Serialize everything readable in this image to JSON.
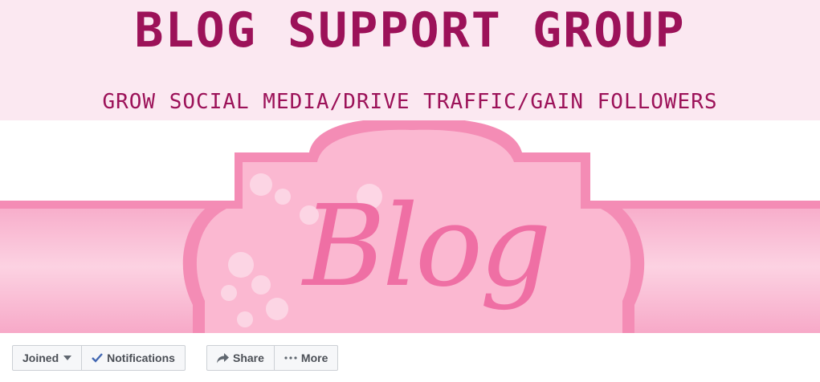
{
  "cover": {
    "title": "BLOG SUPPORT GROUP",
    "subtitle": "GROW SOCIAL MEDIA/DRIVE TRAFFIC/GAIN FOLLOWERS",
    "art_text": "Blog",
    "colors": {
      "title": "#9c1259",
      "band": "#fbe8f1",
      "pink": "#f48cb5",
      "light_pink": "#fcc3d8"
    }
  },
  "actions": {
    "joined_label": "Joined",
    "notifications_label": "Notifications",
    "share_label": "Share",
    "more_label": "More",
    "icons": [
      "caret-down-icon",
      "checkmark-icon",
      "share-arrow-icon",
      "ellipsis-icon"
    ]
  }
}
